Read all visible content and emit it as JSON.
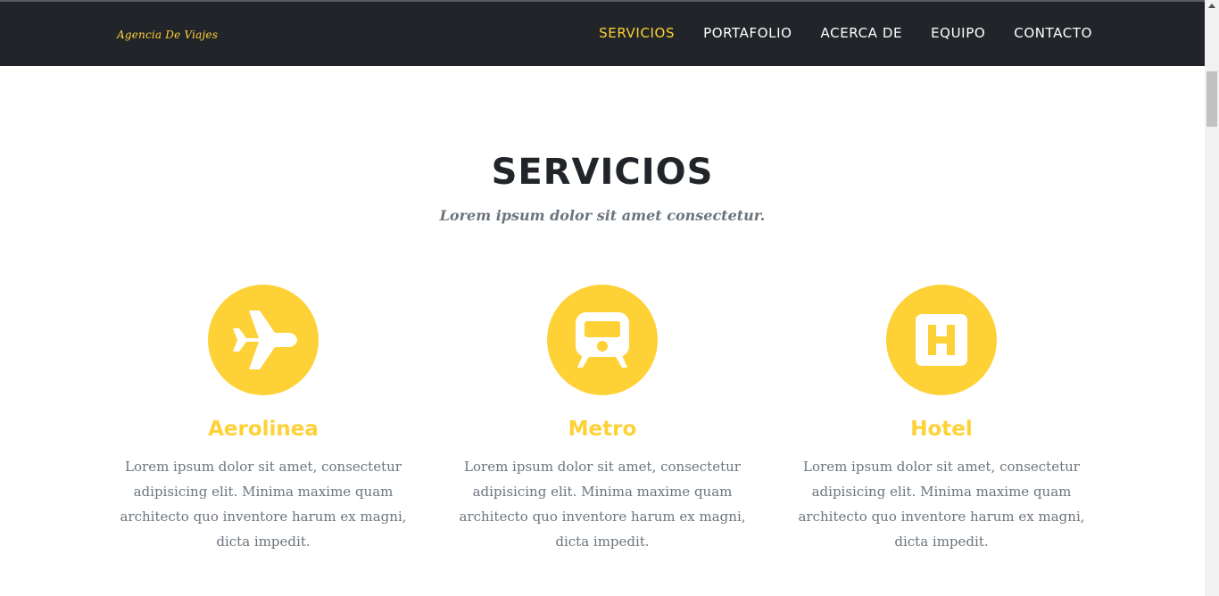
{
  "navbar": {
    "brand": "Agencia De Viajes",
    "links": [
      {
        "label": "SERVICIOS",
        "active": true
      },
      {
        "label": "PORTAFOLIO",
        "active": false
      },
      {
        "label": "ACERCA DE",
        "active": false
      },
      {
        "label": "EQUIPO",
        "active": false
      },
      {
        "label": "CONTACTO",
        "active": false
      }
    ]
  },
  "colors": {
    "accent": "#fed136",
    "navbar_bg": "#212529",
    "heading": "#212529",
    "muted_text": "#6c757d"
  },
  "services_section": {
    "title": "SERVICIOS",
    "subtitle": "Lorem ipsum dolor sit amet consectetur.",
    "items": [
      {
        "icon": "plane-icon",
        "title": "Aerolinea",
        "text": "Lorem ipsum dolor sit amet, consectetur adipisicing elit. Minima maxime quam architecto quo inventore harum ex magni, dicta impedit."
      },
      {
        "icon": "train-icon",
        "title": "Metro",
        "text": "Lorem ipsum dolor sit amet, consectetur adipisicing elit. Minima maxime quam architecto quo inventore harum ex magni, dicta impedit."
      },
      {
        "icon": "hotel-icon",
        "title": "Hotel",
        "text": "Lorem ipsum dolor sit amet, consectetur adipisicing elit. Minima maxime quam architecto quo inventore harum ex magni, dicta impedit."
      }
    ]
  }
}
